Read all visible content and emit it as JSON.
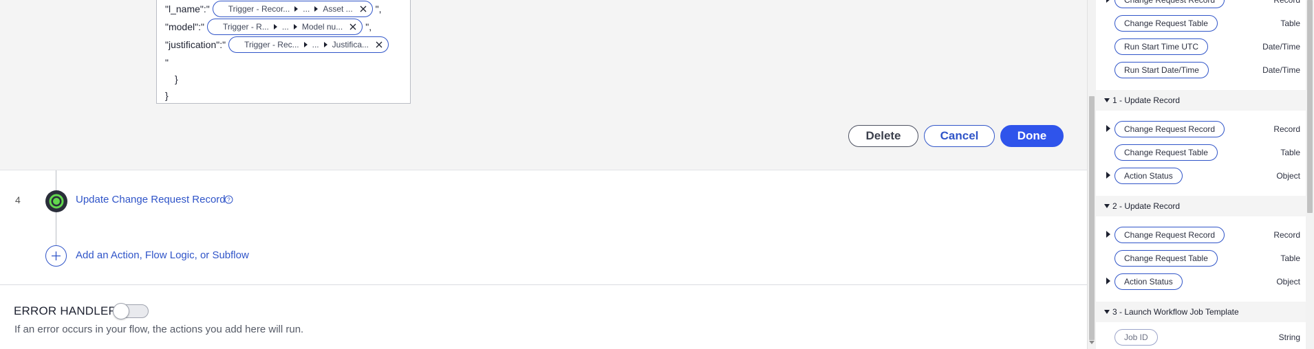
{
  "json_editor": {
    "lines": [
      {
        "key_text": "\"l_name\":\"",
        "pill": {
          "segments": [
            "Trigger - Recor...",
            "...",
            "Asset ..."
          ]
        },
        "suffix": "\","
      },
      {
        "key_text": "\"model\":\"",
        "pill": {
          "segments": [
            "Trigger - R...",
            "...",
            "Model nu..."
          ]
        },
        "suffix": "\","
      },
      {
        "key_text": "\"justification\":\"",
        "pill": {
          "segments": [
            "Trigger - Rec...",
            "...",
            "Justifica..."
          ]
        },
        "suffix": ""
      }
    ],
    "quote_line": "\"",
    "close_inner": "}",
    "close_outer": "}"
  },
  "actions": {
    "delete_label": "Delete",
    "cancel_label": "Cancel",
    "done_label": "Done",
    "done_color": "#2f54eb"
  },
  "flow": {
    "step_number": "4",
    "step_title": "Update Change Request Record",
    "step_icon": "status-circle-icon",
    "step_icon_color": "#62d84e",
    "add_label": "Add an Action, Flow Logic, or Subflow"
  },
  "error_handler": {
    "title": "ERROR HANDLER",
    "toggle_on": false,
    "description": "If an error occurs in your flow, the actions you add here will run."
  },
  "data_panel": {
    "trigger_items": [
      {
        "label": "Change Request Record",
        "type": "Record",
        "expandable": true
      },
      {
        "label": "Change Request Table",
        "type": "Table",
        "expandable": false
      },
      {
        "label": "Run Start Time UTC",
        "type": "Date/Time",
        "expandable": false
      },
      {
        "label": "Run Start Date/Time",
        "type": "Date/Time",
        "expandable": false
      }
    ],
    "sections": [
      {
        "title": "1 - Update Record",
        "items": [
          {
            "label": "Change Request Record",
            "type": "Record",
            "expandable": true
          },
          {
            "label": "Change Request Table",
            "type": "Table",
            "expandable": false
          },
          {
            "label": "Action Status",
            "type": "Object",
            "expandable": true
          }
        ]
      },
      {
        "title": "2 - Update Record",
        "items": [
          {
            "label": "Change Request Record",
            "type": "Record",
            "expandable": true
          },
          {
            "label": "Change Request Table",
            "type": "Table",
            "expandable": false
          },
          {
            "label": "Action Status",
            "type": "Object",
            "expandable": true
          }
        ]
      },
      {
        "title": "3 - Launch Workflow Job Template",
        "items": [
          {
            "label": "Job ID",
            "type": "String",
            "expandable": false,
            "muted": true
          }
        ]
      }
    ]
  }
}
